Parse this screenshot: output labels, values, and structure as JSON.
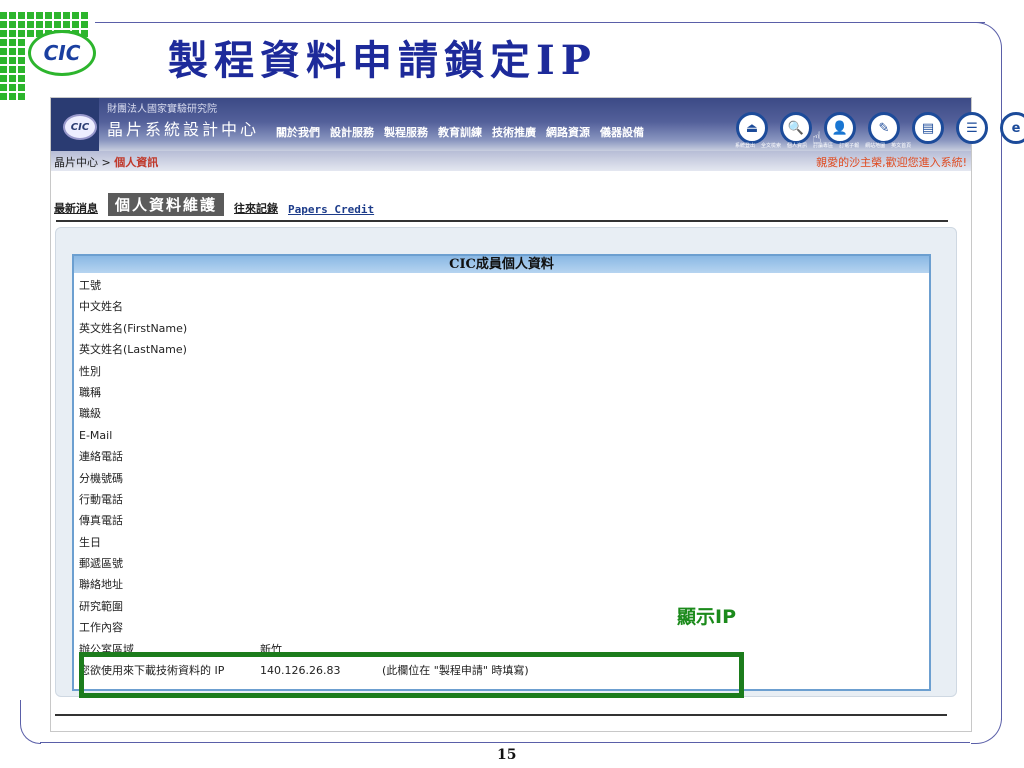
{
  "slide": {
    "logo_text": "CIC",
    "title": "製程資料申請鎖定IP",
    "annotation": "顯示IP",
    "page_number": "15",
    "highlight_color": "#1c7c1c"
  },
  "site": {
    "org_name": "財團法人國家實驗研究院",
    "center_name": "晶片系統設計中心",
    "logo_text": "CIC",
    "nav": [
      "關於我們",
      "設計服務",
      "製程服務",
      "教育訓練",
      "技術推廣",
      "網路資源",
      "儀器設備"
    ],
    "toolbar_icons": [
      {
        "name": "system-exit-icon",
        "glyph": "⏏",
        "label": "系統登出"
      },
      {
        "name": "search-icon",
        "glyph": "🔍",
        "label": "全文檢索"
      },
      {
        "name": "person-icon",
        "glyph": "👤",
        "label": "個人資訊"
      },
      {
        "name": "discussion-icon",
        "glyph": "✎",
        "label": "討論專區"
      },
      {
        "name": "newsletter-icon",
        "glyph": "▤",
        "label": "訂電子報"
      },
      {
        "name": "sitemap-icon",
        "glyph": "☰",
        "label": "網站地圖"
      },
      {
        "name": "english-icon",
        "glyph": "e",
        "label": "英文首頁"
      }
    ],
    "breadcrumb_root": "晶片中心",
    "breadcrumb_sep": " > ",
    "breadcrumb_current": "個人資訊",
    "welcome": "親愛的沙主榮,歡迎您進入系統!"
  },
  "tabs": {
    "news": "最新消息",
    "profile": "個人資料維護",
    "records": "往來記錄",
    "papers": "Papers Credit"
  },
  "card": {
    "title": "CIC成員個人資料",
    "rows": [
      {
        "label": "工號",
        "value": ""
      },
      {
        "label": "中文姓名",
        "value": ""
      },
      {
        "label": "英文姓名(FirstName)",
        "value": ""
      },
      {
        "label": "英文姓名(LastName)",
        "value": ""
      },
      {
        "label": "性別",
        "value": ""
      },
      {
        "label": "職稱",
        "value": ""
      },
      {
        "label": "職級",
        "value": ""
      },
      {
        "label": "E-Mail",
        "value": ""
      },
      {
        "label": "連絡電話",
        "value": ""
      },
      {
        "label": "分機號碼",
        "value": ""
      },
      {
        "label": "行動電話",
        "value": ""
      },
      {
        "label": "傳真電話",
        "value": ""
      },
      {
        "label": "生日",
        "value": ""
      },
      {
        "label": "郵遞區號",
        "value": ""
      },
      {
        "label": "聯絡地址",
        "value": ""
      },
      {
        "label": "研究範圍",
        "value": ""
      },
      {
        "label": "工作內容",
        "value": ""
      },
      {
        "label": "辦公室區域",
        "value": "新竹"
      }
    ],
    "ip_row": {
      "label": "您欲使用來下載技術資料的 IP",
      "value": "140.126.26.83",
      "note": "(此欄位在 \"製程申請\" 時填寫)"
    }
  }
}
